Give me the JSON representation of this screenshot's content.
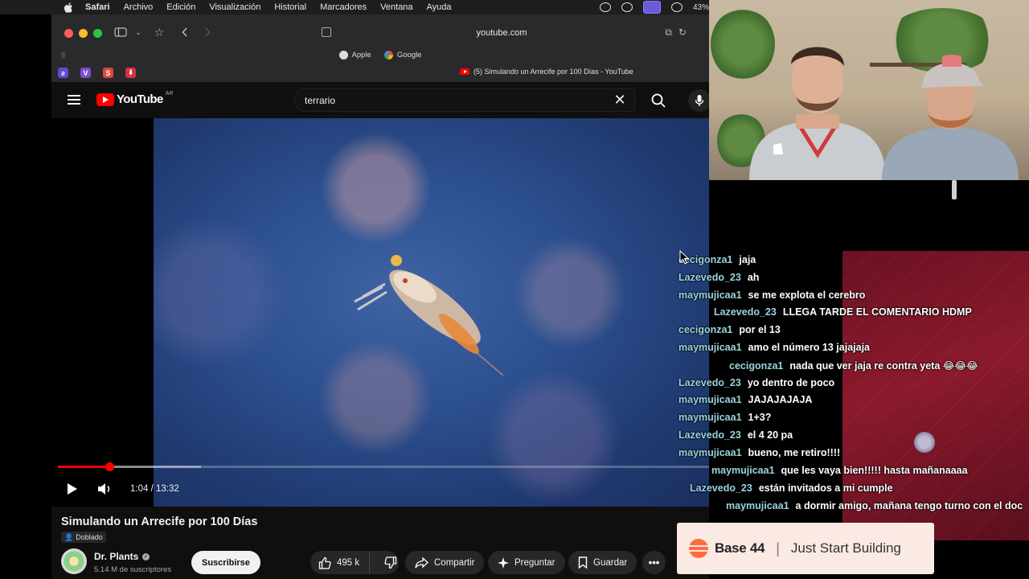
{
  "menubar": {
    "app_name": "Safari",
    "items": [
      "Archivo",
      "Edición",
      "Visualización",
      "Historial",
      "Marcadores",
      "Ventana",
      "Ayuda"
    ],
    "battery": "43%"
  },
  "browser": {
    "address": "youtube.com",
    "favorites": [
      "Apple",
      "Google"
    ],
    "active_tab_title": "(5) Simulando un Arrecife por 100 Días - YouTube",
    "extensions": [
      "ƨ",
      "V",
      "S",
      "⬇"
    ]
  },
  "youtube": {
    "logo_text": "YouTube",
    "country_code": "AR",
    "search_value": "terrario",
    "player": {
      "current_time": "1:04",
      "duration": "13:32",
      "played_fraction": 0.079,
      "loaded_fraction": 0.22
    },
    "video": {
      "title": "Simulando un Arrecife por 100 Días",
      "dub_badge": "Doblado",
      "channel_name": "Dr. Plants",
      "subscribers": "5.14 M de suscriptores",
      "subscribe_label": "Suscribirse",
      "likes": "495 k",
      "share_label": "Compartir",
      "ask_label": "Preguntar",
      "save_label": "Guardar"
    }
  },
  "chat": {
    "colors": {
      "user": "#9ad3e0",
      "msg": "#ffffff"
    },
    "messages": [
      {
        "user": "cecigonza1",
        "text": "jaja"
      },
      {
        "user": "Lazevedo_23",
        "text": "ah"
      },
      {
        "user": "maymujicaa1",
        "text": "se me explota el cerebro"
      },
      {
        "user": "Lazevedo_23",
        "text": "LLEGA TARDE EL COMENTARIO HDMP"
      },
      {
        "user": "cecigonza1",
        "text": "por el 13"
      },
      {
        "user": "maymujicaa1",
        "text": "amo el número 13 jajajaja"
      },
      {
        "user": "cecigonza1",
        "text": "nada que ver jaja re contra yeta 😂😂😂"
      },
      {
        "user": "Lazevedo_23",
        "text": "yo dentro de poco"
      },
      {
        "user": "maymujicaa1",
        "text": "JAJAJAJAJA"
      },
      {
        "user": "maymujicaa1",
        "text": "1+3?"
      },
      {
        "user": "Lazevedo_23",
        "text": "el 4 20 pa"
      },
      {
        "user": "maymujicaa1",
        "text": "bueno, me retiro!!!!"
      },
      {
        "user": "maymujicaa1",
        "text": "que les vaya bien!!!!! hasta mañanaaaa"
      },
      {
        "user": "Lazevedo_23",
        "text": "están invitados a mi cumple"
      },
      {
        "user": "maymujicaa1",
        "text": "a dormir amigo, mañana tengo turno con el doc"
      }
    ]
  },
  "ad": {
    "brand": "Base 44",
    "separator": "|",
    "tagline": "Just Start Building"
  }
}
